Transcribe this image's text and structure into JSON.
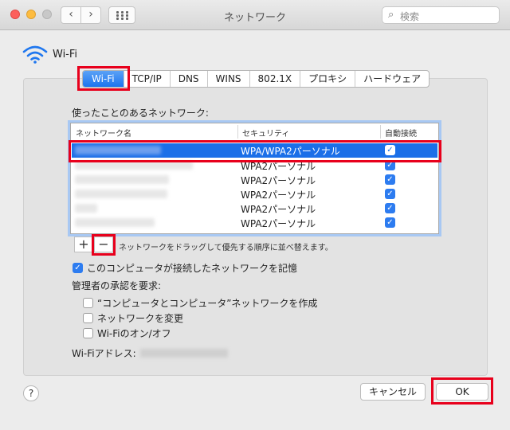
{
  "window": {
    "title": "ネットワーク"
  },
  "toolbar": {
    "back": "‹",
    "forward": "›",
    "search_placeholder": "検索",
    "search_icon": "magnifier-icon"
  },
  "interface": {
    "name": "Wi-Fi",
    "icon": "wifi-icon"
  },
  "tabs": [
    "Wi-Fi",
    "TCP/IP",
    "DNS",
    "WINS",
    "802.1X",
    "プロキシ",
    "ハードウェア"
  ],
  "active_tab": "Wi-Fi",
  "known_networks": {
    "label": "使ったことのあるネットワーク:",
    "columns": {
      "name": "ネットワーク名",
      "security": "セキュリティ",
      "auto_join": "自動接続"
    },
    "rows": [
      {
        "security": "WPA/WPA2パーソナル",
        "auto_join": true,
        "selected": true
      },
      {
        "security": "WPA2パーソナル",
        "auto_join": true,
        "selected": false
      },
      {
        "security": "WPA2パーソナル",
        "auto_join": true,
        "selected": false
      },
      {
        "security": "WPA2パーソナル",
        "auto_join": true,
        "selected": false
      },
      {
        "security": "WPA2パーソナル",
        "auto_join": true,
        "selected": false
      },
      {
        "security": "WPA2パーソナル",
        "auto_join": true,
        "selected": false
      }
    ],
    "add_label": "+",
    "remove_label": "−",
    "drag_hint": "ネットワークをドラッグして優先する順序に並べ替えます。"
  },
  "remember_networks": {
    "label": "このコンピュータが接続したネットワークを記憶",
    "checked": true
  },
  "admin": {
    "label": "管理者の承認を要求:",
    "options": [
      {
        "label": "“コンピュータとコンピュータ”ネットワークを作成",
        "checked": false
      },
      {
        "label": "ネットワークを変更",
        "checked": false
      },
      {
        "label": "Wi-Fiのオン/オフ",
        "checked": false
      }
    ]
  },
  "wifi_address": {
    "label": "Wi-Fiアドレス:"
  },
  "footer": {
    "help": "?",
    "cancel": "キャンセル",
    "ok": "OK"
  },
  "colors": {
    "accent": "#1b6fe8",
    "highlight_box": "#e8001c"
  }
}
